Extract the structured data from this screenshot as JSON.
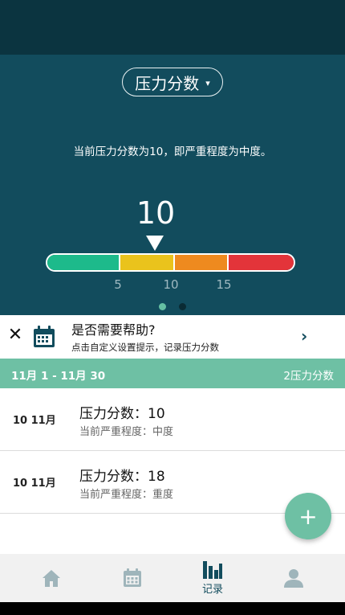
{
  "metric_selector": {
    "label": "压力分数",
    "caret": "▾"
  },
  "summary": "当前压力分数为10，即严重程度为中度。",
  "gauge": {
    "score": "10",
    "ticks": [
      "5",
      "10",
      "15"
    ],
    "segment_colors": [
      "#1dba8b",
      "#eac31c",
      "#ee8a1f",
      "#e3343a"
    ]
  },
  "pager": {
    "pages": 2,
    "active": 1
  },
  "help_card": {
    "title": "是否需要帮助?",
    "subtitle": "点击自定义设置提示，记录压力分数",
    "close_glyph": "✕",
    "chevron_glyph": "›",
    "icon": "calendar-icon"
  },
  "range": {
    "label": "11月 1 - 11月 30",
    "count": "2压力分数"
  },
  "records": [
    {
      "date": "10 11月",
      "title": "压力分数：10",
      "severity": "当前严重程度：中度"
    },
    {
      "date": "10 11月",
      "title": "压力分数：18",
      "severity": "当前严重程度：重度"
    }
  ],
  "fab": {
    "glyph": "+"
  },
  "bottom_nav": {
    "items": [
      {
        "icon": "home-icon",
        "label": ""
      },
      {
        "icon": "calendar-icon",
        "label": ""
      },
      {
        "icon": "bar-chart-icon",
        "label": "记录"
      },
      {
        "icon": "person-icon",
        "label": ""
      }
    ]
  },
  "colors": {
    "status_bar": "#0b3440",
    "hero": "#124c5d",
    "accent": "#6ec0a4",
    "nav_inactive": "#9fb5bb"
  }
}
